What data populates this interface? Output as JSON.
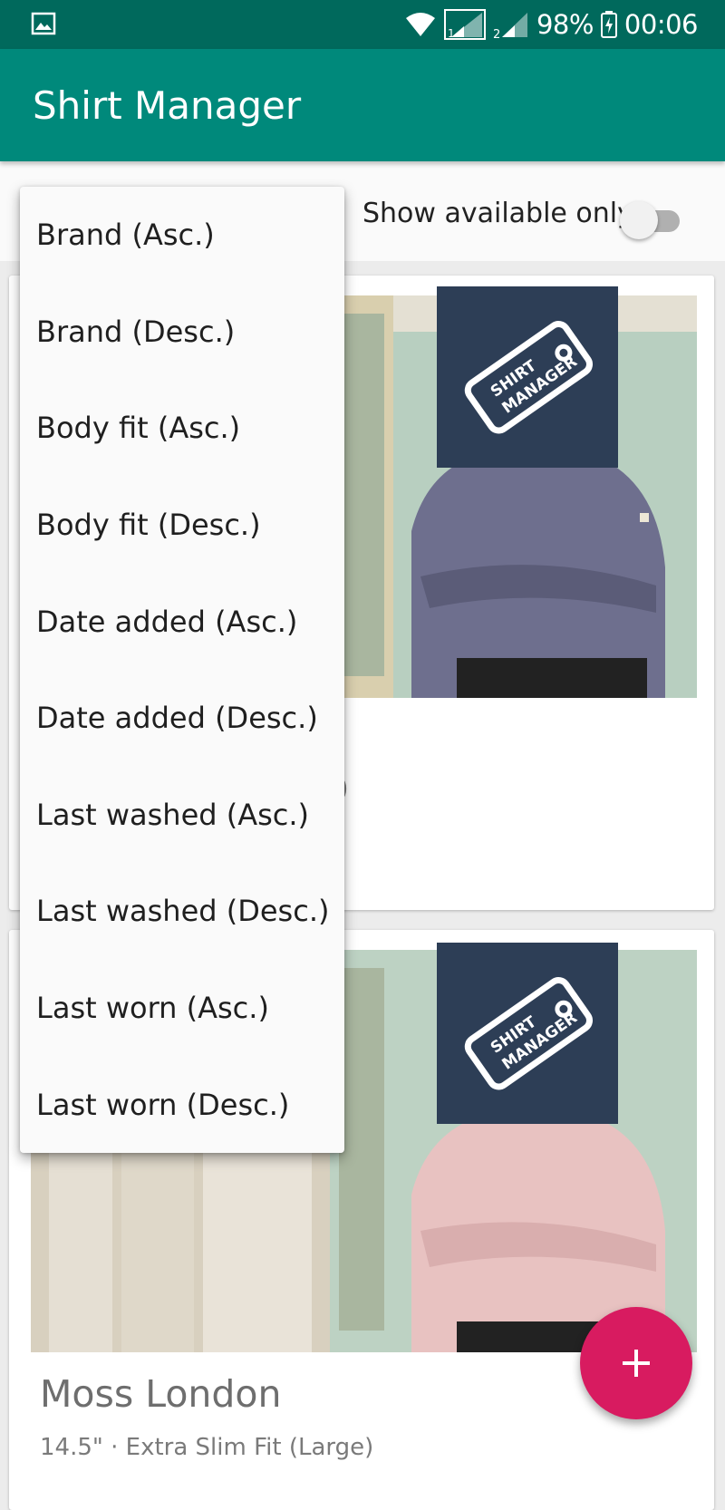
{
  "status_bar": {
    "battery": "98%",
    "time": "00:06",
    "icons": [
      "image-notification-icon",
      "wifi-icon",
      "signal-sim1-icon",
      "signal-sim2-icon",
      "battery-charging-icon"
    ]
  },
  "app_bar": {
    "title": "Shirt Manager"
  },
  "filters": {
    "available_only_label": "Show available only",
    "available_only_on": false
  },
  "sort_menu": {
    "items": [
      "Brand (Asc.)",
      "Brand (Desc.)",
      "Body fit (Asc.)",
      "Body fit (Desc.)",
      "Date added (Asc.)",
      "Date added (Desc.)",
      "Last washed (Asc.)",
      "Last washed (Desc.)",
      "Last worn (Asc.)",
      "Last worn (Desc.)"
    ]
  },
  "cards": [
    {
      "paren_fragment": ")"
    },
    {
      "brand": "Moss London",
      "subtitle": "14.5\" · Extra Slim Fit (Large)"
    }
  ],
  "logo": {
    "text_line1": "SHIRT",
    "text_line2": "MANAGER"
  },
  "colors": {
    "primary": "#00897b",
    "primary_dark": "#00695c",
    "accent": "#d81b60",
    "logo_bg": "#2d3e56"
  },
  "fab": {
    "label": "+"
  }
}
